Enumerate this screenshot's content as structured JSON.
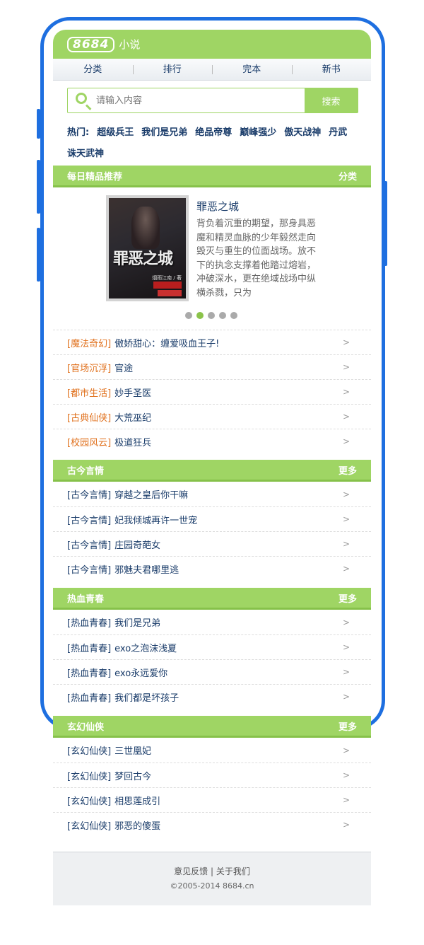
{
  "header": {
    "logo": "8684",
    "logo_text": "小说"
  },
  "nav": [
    "分类",
    "排行",
    "完本",
    "新书"
  ],
  "search": {
    "placeholder": "请输入内容",
    "button": "搜索"
  },
  "hot": {
    "label": "热门:",
    "items": [
      "超级兵王",
      "我们是兄弟",
      "绝品帝尊",
      "巅峰强少",
      "傲天战神",
      "丹武",
      "诛天武神"
    ]
  },
  "featured_section": {
    "title": "每日精品推荐",
    "more": "分类"
  },
  "featured": {
    "cover_title": "罪恶之城",
    "cover_author": "烟雨江南 / 著",
    "title": "罪恶之城",
    "description": "背负着沉重的期望，那身具恶魔和精灵血脉的少年毅然走向毁灭与重生的位面战场。放不下的执念支撑着他踏过熔岩，冲破深水，更在绝域战场中纵横杀戮，只为"
  },
  "recommend": [
    {
      "category": "[魔法奇幻]",
      "name": "傲娇甜心：缠爱吸血王子!"
    },
    {
      "category": "[官场沉浮]",
      "name": "官途"
    },
    {
      "category": "[都市生活]",
      "name": "妙手圣医"
    },
    {
      "category": "[古典仙侠]",
      "name": "大荒巫纪"
    },
    {
      "category": "[校园风云]",
      "name": "极道狂兵"
    }
  ],
  "sections": [
    {
      "title": "古今言情",
      "more": "更多",
      "items": [
        {
          "category": "[古今言情]",
          "name": "穿越之皇后你干嘛"
        },
        {
          "category": "[古今言情]",
          "name": "妃我倾城再许一世宠"
        },
        {
          "category": "[古今言情]",
          "name": "庄园奇葩女"
        },
        {
          "category": "[古今言情]",
          "name": "邪魅夫君哪里逃"
        }
      ]
    },
    {
      "title": "热血青春",
      "more": "更多",
      "items": [
        {
          "category": "[热血青春]",
          "name": "我们是兄弟"
        },
        {
          "category": "[热血青春]",
          "name": "exo之泡沫浅夏"
        },
        {
          "category": "[热血青春]",
          "name": "exo永远爱你"
        },
        {
          "category": "[热血青春]",
          "name": "我们都是坏孩子"
        }
      ]
    },
    {
      "title": "玄幻仙侠",
      "more": "更多",
      "items": [
        {
          "category": "[玄幻仙侠]",
          "name": "三世凰妃"
        },
        {
          "category": "[玄幻仙侠]",
          "name": "梦回古今"
        },
        {
          "category": "[玄幻仙侠]",
          "name": "相思莲成引"
        },
        {
          "category": "[玄幻仙侠]",
          "name": "邪恶的傻蛋"
        }
      ]
    }
  ],
  "arrow": ">",
  "footer": {
    "feedback": "意见反馈",
    "sep": "|",
    "about": "关于我们",
    "copyright": "©2005-2014 8684.cn"
  },
  "colors": {
    "accent": "#9fd564",
    "frame": "#1e6fe0",
    "link": "#1a3c6a",
    "category_highlight": "#e0701c"
  }
}
